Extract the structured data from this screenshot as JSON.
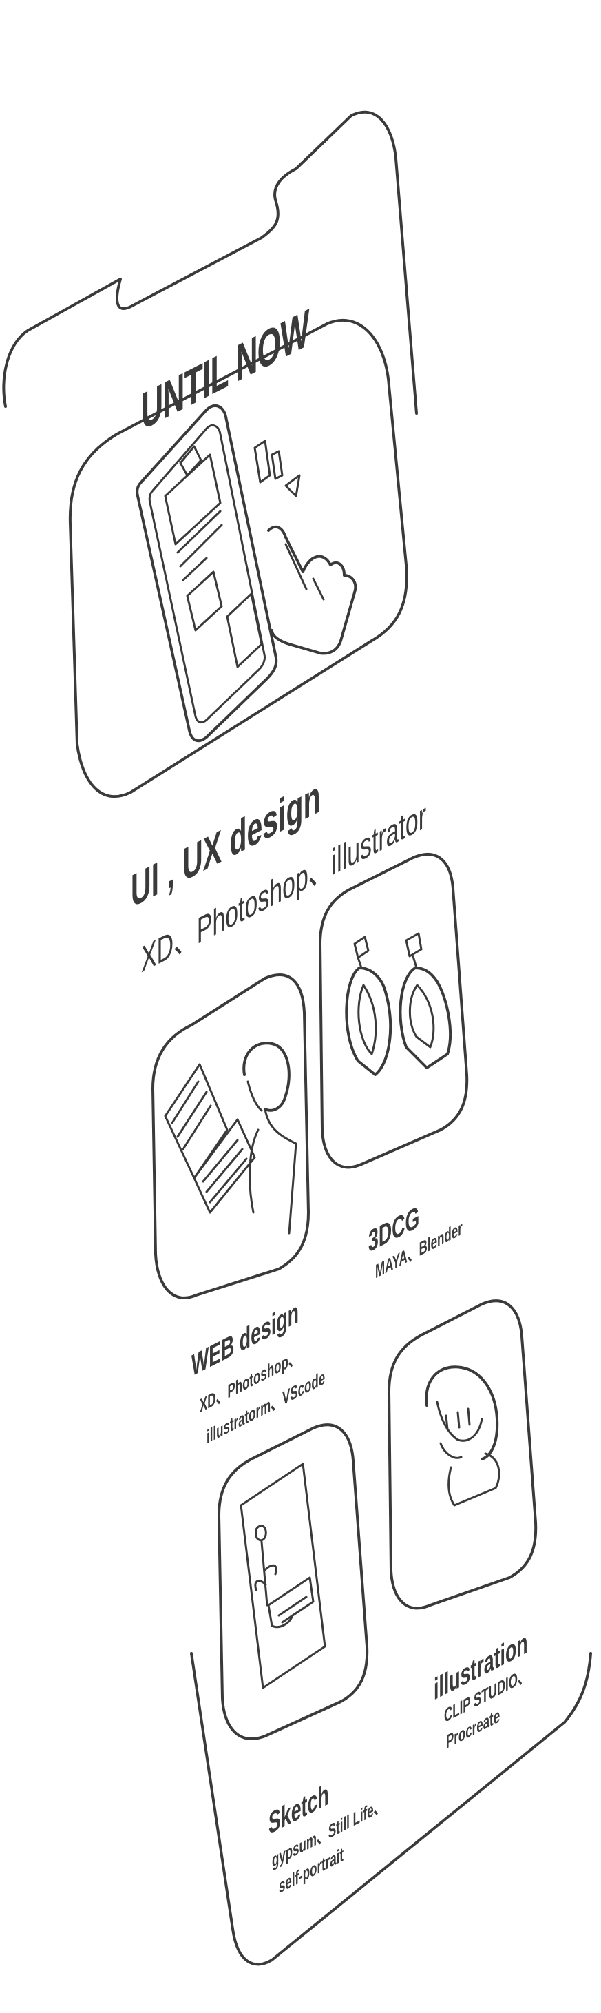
{
  "heading": "UNTIL  NOW",
  "colors": {
    "line": "#3a3a3a",
    "background": "#ffffff"
  },
  "skills": [
    {
      "title": "UI , UX design",
      "tools": [
        "XD、Photoshop、illustrator"
      ],
      "icon": "phone-tap-icon"
    },
    {
      "title": "WEB design",
      "tools": [
        "XD、Photoshop、",
        "illustratorm、VScode"
      ],
      "icon": "laptop-person-icon"
    },
    {
      "title": "3DCG",
      "tools": [
        "MAYA、Blender"
      ],
      "icon": "earrings-icon"
    },
    {
      "title": "illustration",
      "tools": [
        "CLIP  STUDIO、",
        "Procreate"
      ],
      "icon": "girl-portrait-icon"
    },
    {
      "title": "Sketch",
      "tools": [
        "gypsum、Still Life、",
        "self-portrait"
      ],
      "icon": "still-life-drawing-icon"
    }
  ]
}
